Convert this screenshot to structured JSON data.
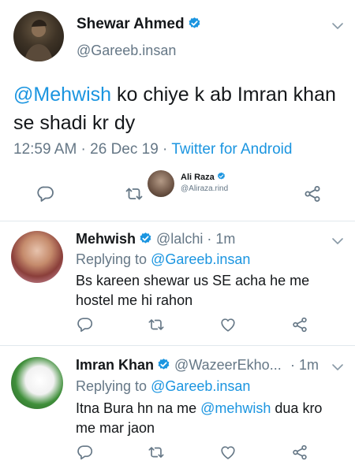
{
  "main_tweet": {
    "name": "Shewar Ahmed",
    "handle": "@Gareeb.insan",
    "mention": "@Mehwish",
    "text_rest": " ko chiye k ab Imran khan se shadi kr dy",
    "time": "12:59 AM · 26 Dec 19 · ",
    "source": "Twitter for Android",
    "tag_overlay": {
      "name": "Ali Raza",
      "handle": "@Aliraza.rind"
    }
  },
  "replies": [
    {
      "name": "Mehwish",
      "handle": "@lalchi",
      "time": "· 1m",
      "replying_label": "Replying to ",
      "replying_handle": "@Gareeb.insan",
      "text": "Bs kareen shewar us SE acha he me hostel me hi rahon"
    },
    {
      "name": "Imran Khan",
      "handle": "@WazeerEkho...",
      "time": "· 1m",
      "replying_label": "Replying to ",
      "replying_handle": "@Gareeb.insan",
      "text_before": "Itna Bura hn na me ",
      "mention": "@mehwish",
      "text_after": " dua kro me mar jaon"
    }
  ],
  "colors": {
    "accent": "#1b95e0",
    "secondary_text": "#657786",
    "separator": "#e1e8ed"
  },
  "icons": [
    "reply-icon",
    "retweet-icon",
    "like-icon",
    "share-icon",
    "verified-icon",
    "chevron-down-icon"
  ]
}
